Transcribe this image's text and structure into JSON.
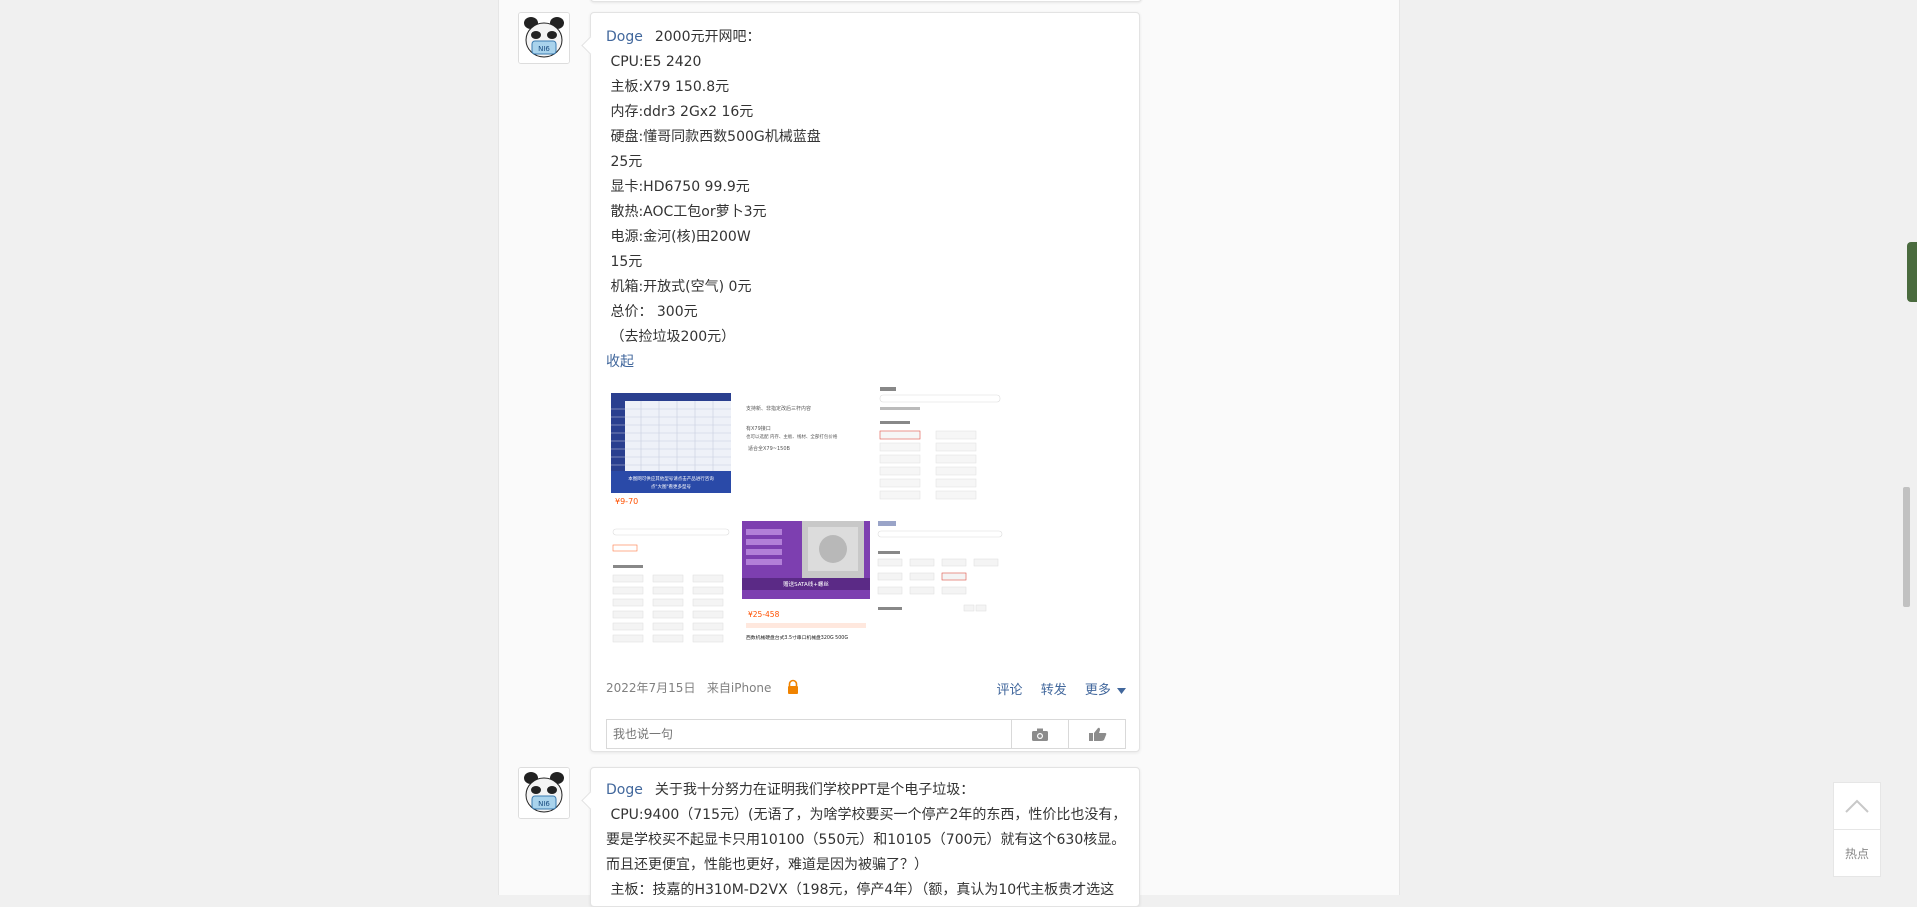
{
  "post1": {
    "author": "Doge",
    "avatar_badge": "NI6",
    "lines": [
      "2000元开网吧：",
      "CPU:E5 2420",
      "主板:X79 150.8元",
      "内存:ddr3 2Gx2 16元",
      "硬盘:懂哥同款西数500G机械蓝盘",
      "25元",
      "显卡:HD6750 99.9元",
      "散热:AOC工包or萝卜3元",
      "电源:金河(核)田200W",
      "15元",
      "机箱:开放式(空气) 0元",
      "总价： 300元",
      "（去捡垃圾200元）"
    ],
    "collapse_label": "收起",
    "images": {
      "tile1_caption": "本图网可供应其他型号请点击产品进行咨询",
      "tile1_sub": "点\"大图\"看更多型号",
      "tile1_price": "¥9-70",
      "tile2_lines": [
        "支持新、非指定改后三杆内容",
        "有X79接口",
        "也可以选配 内存、主板、线材、全部打包价格",
        "适合全X79~150B"
      ],
      "tile5_banner": "赠送SATA线+螺丝",
      "tile5_price": "¥25-458",
      "tile5_title": "西数机械硬盘台式3.5寸串口机械盘320G 500G"
    },
    "date": "2022年7月15日",
    "source": "来自iPhone",
    "actions": [
      "评论",
      "转发",
      "更多"
    ],
    "comment_placeholder": "我也说一句"
  },
  "post2": {
    "author": "Doge",
    "avatar_badge": "NI6",
    "text": "关于我十分努力在证明我们学校PPT是个电子垃圾：",
    "lines": [
      "CPU:9400（715元）(无语了，为啥学校要买一个停产2年的东西，性价比也没有，要是学校买不起显卡只用10100（550元）和10105（700元）就有这个630核显。而且还更便宜，性能也更好，难道是因为被骗了？）",
      "主板：技嘉的H310M-D2VX（198元，停产4年）（额，真认为10代主板贵才选这"
    ]
  },
  "float": {
    "hot_label": "热点"
  },
  "colors": {
    "link": "#41679c",
    "lock": "#f08300"
  }
}
